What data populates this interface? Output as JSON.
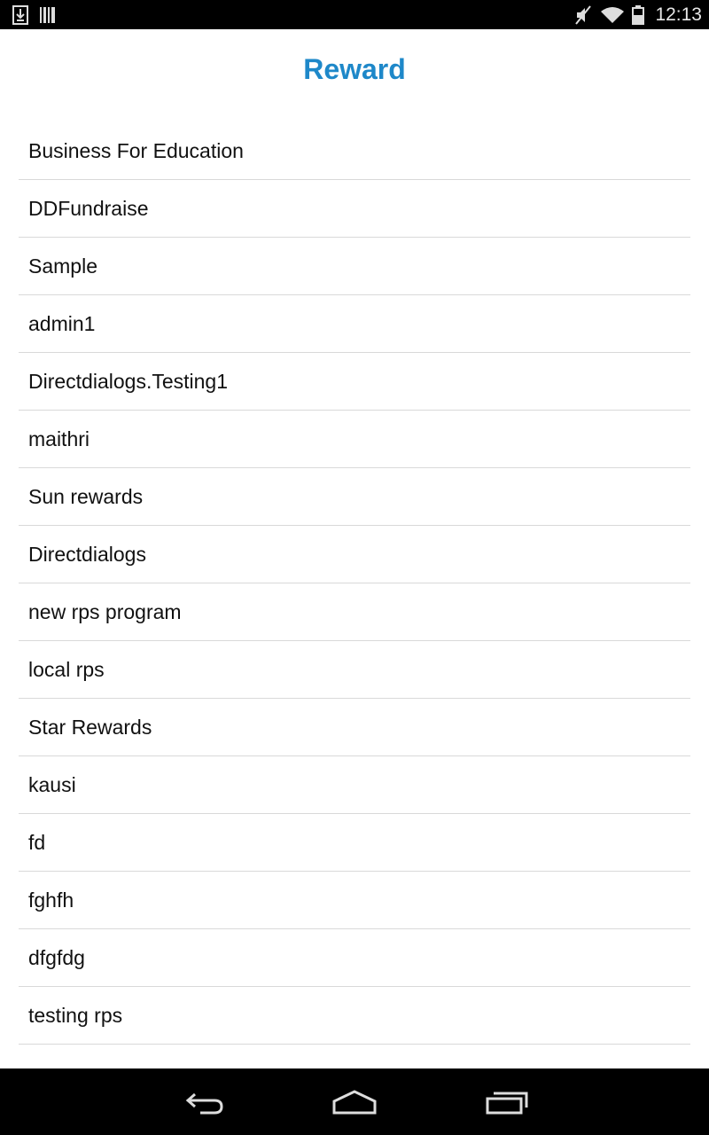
{
  "status_bar": {
    "time": "12:13",
    "icons": [
      "download-icon",
      "barcode-icon",
      "mute-icon",
      "wifi-icon",
      "battery-icon"
    ]
  },
  "header": {
    "title": "Reward",
    "title_color": "#1e88c9"
  },
  "rewards": [
    {
      "label": "Business For Education"
    },
    {
      "label": "DDFundraise"
    },
    {
      "label": "Sample"
    },
    {
      "label": "admin1"
    },
    {
      "label": "Directdialogs.Testing1"
    },
    {
      "label": "maithri"
    },
    {
      "label": "Sun rewards"
    },
    {
      "label": "Directdialogs"
    },
    {
      "label": "new rps program"
    },
    {
      "label": "local rps"
    },
    {
      "label": "Star Rewards"
    },
    {
      "label": "kausi"
    },
    {
      "label": "fd"
    },
    {
      "label": "fghfh"
    },
    {
      "label": "dfgfdg"
    },
    {
      "label": "testing rps"
    }
  ],
  "nav_bar": {
    "icons": [
      "back-icon",
      "home-icon",
      "recent-apps-icon"
    ]
  }
}
